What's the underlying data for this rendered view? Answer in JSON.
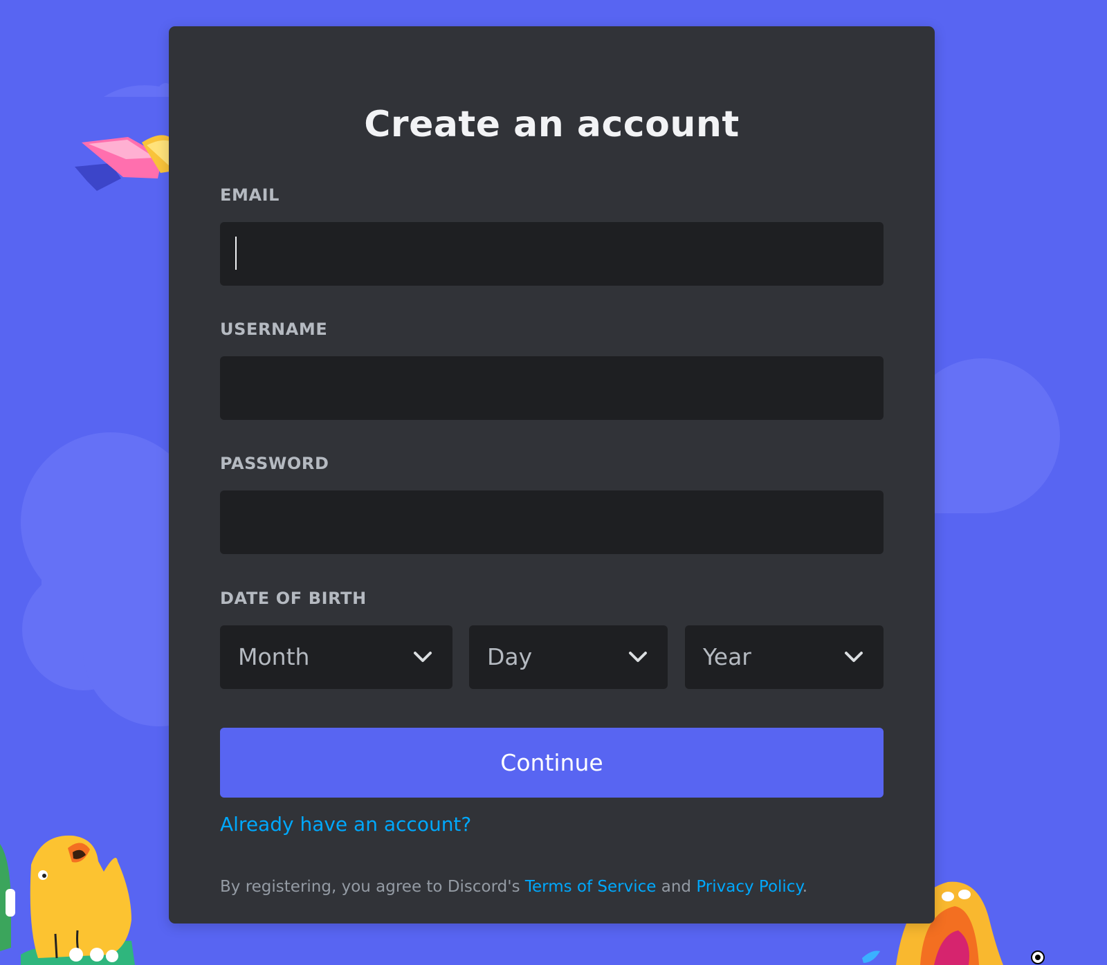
{
  "form": {
    "title": "Create an account",
    "email": {
      "label": "EMAIL",
      "value": "",
      "placeholder": ""
    },
    "username": {
      "label": "USERNAME",
      "value": "",
      "placeholder": ""
    },
    "password": {
      "label": "PASSWORD",
      "value": "",
      "placeholder": ""
    },
    "date_of_birth": {
      "label": "DATE OF BIRTH",
      "month": {
        "placeholder": "Month"
      },
      "day": {
        "placeholder": "Day"
      },
      "year": {
        "placeholder": "Year"
      }
    },
    "continue_label": "Continue",
    "login_link": "Already have an account?",
    "legal": {
      "prefix": "By registering, you agree to Discord's ",
      "terms": "Terms of Service",
      "and": " and ",
      "privacy": "Privacy Policy",
      "suffix": "."
    }
  },
  "colors": {
    "background": "#5865f2",
    "card": "#313338",
    "input": "#1e1f22",
    "accent": "#5865f2",
    "link": "#00a8fc",
    "label": "#b5bac1"
  },
  "icons": {
    "select_chevron": "chevron-down-icon",
    "decorations": [
      "cloud-shape",
      "flying-book-illustration",
      "yellow-creature-illustration",
      "green-creature-illustration",
      "orange-creature-illustration",
      "droplet-shape",
      "cursor-ring"
    ]
  }
}
